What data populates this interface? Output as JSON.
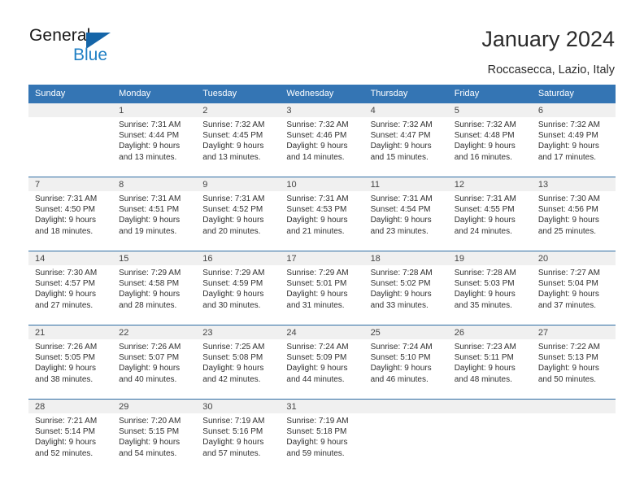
{
  "brand": {
    "name_top": "General",
    "name_bottom": "Blue",
    "triangle_color": "#1565a8",
    "blue_color": "#1f7fc4"
  },
  "header": {
    "title": "January 2024",
    "location": "Roccasecca, Lazio, Italy"
  },
  "calendar": {
    "header_bg": "#3475b4",
    "row_border": "#2e6da4",
    "daynum_bg": "#f0f0f0",
    "weekdays": [
      "Sunday",
      "Monday",
      "Tuesday",
      "Wednesday",
      "Thursday",
      "Friday",
      "Saturday"
    ],
    "weeks": [
      [
        {
          "day": "",
          "sunrise": "",
          "sunset": "",
          "daylight1": "",
          "daylight2": ""
        },
        {
          "day": "1",
          "sunrise": "Sunrise: 7:31 AM",
          "sunset": "Sunset: 4:44 PM",
          "daylight1": "Daylight: 9 hours",
          "daylight2": "and 13 minutes."
        },
        {
          "day": "2",
          "sunrise": "Sunrise: 7:32 AM",
          "sunset": "Sunset: 4:45 PM",
          "daylight1": "Daylight: 9 hours",
          "daylight2": "and 13 minutes."
        },
        {
          "day": "3",
          "sunrise": "Sunrise: 7:32 AM",
          "sunset": "Sunset: 4:46 PM",
          "daylight1": "Daylight: 9 hours",
          "daylight2": "and 14 minutes."
        },
        {
          "day": "4",
          "sunrise": "Sunrise: 7:32 AM",
          "sunset": "Sunset: 4:47 PM",
          "daylight1": "Daylight: 9 hours",
          "daylight2": "and 15 minutes."
        },
        {
          "day": "5",
          "sunrise": "Sunrise: 7:32 AM",
          "sunset": "Sunset: 4:48 PM",
          "daylight1": "Daylight: 9 hours",
          "daylight2": "and 16 minutes."
        },
        {
          "day": "6",
          "sunrise": "Sunrise: 7:32 AM",
          "sunset": "Sunset: 4:49 PM",
          "daylight1": "Daylight: 9 hours",
          "daylight2": "and 17 minutes."
        }
      ],
      [
        {
          "day": "7",
          "sunrise": "Sunrise: 7:31 AM",
          "sunset": "Sunset: 4:50 PM",
          "daylight1": "Daylight: 9 hours",
          "daylight2": "and 18 minutes."
        },
        {
          "day": "8",
          "sunrise": "Sunrise: 7:31 AM",
          "sunset": "Sunset: 4:51 PM",
          "daylight1": "Daylight: 9 hours",
          "daylight2": "and 19 minutes."
        },
        {
          "day": "9",
          "sunrise": "Sunrise: 7:31 AM",
          "sunset": "Sunset: 4:52 PM",
          "daylight1": "Daylight: 9 hours",
          "daylight2": "and 20 minutes."
        },
        {
          "day": "10",
          "sunrise": "Sunrise: 7:31 AM",
          "sunset": "Sunset: 4:53 PM",
          "daylight1": "Daylight: 9 hours",
          "daylight2": "and 21 minutes."
        },
        {
          "day": "11",
          "sunrise": "Sunrise: 7:31 AM",
          "sunset": "Sunset: 4:54 PM",
          "daylight1": "Daylight: 9 hours",
          "daylight2": "and 23 minutes."
        },
        {
          "day": "12",
          "sunrise": "Sunrise: 7:31 AM",
          "sunset": "Sunset: 4:55 PM",
          "daylight1": "Daylight: 9 hours",
          "daylight2": "and 24 minutes."
        },
        {
          "day": "13",
          "sunrise": "Sunrise: 7:30 AM",
          "sunset": "Sunset: 4:56 PM",
          "daylight1": "Daylight: 9 hours",
          "daylight2": "and 25 minutes."
        }
      ],
      [
        {
          "day": "14",
          "sunrise": "Sunrise: 7:30 AM",
          "sunset": "Sunset: 4:57 PM",
          "daylight1": "Daylight: 9 hours",
          "daylight2": "and 27 minutes."
        },
        {
          "day": "15",
          "sunrise": "Sunrise: 7:29 AM",
          "sunset": "Sunset: 4:58 PM",
          "daylight1": "Daylight: 9 hours",
          "daylight2": "and 28 minutes."
        },
        {
          "day": "16",
          "sunrise": "Sunrise: 7:29 AM",
          "sunset": "Sunset: 4:59 PM",
          "daylight1": "Daylight: 9 hours",
          "daylight2": "and 30 minutes."
        },
        {
          "day": "17",
          "sunrise": "Sunrise: 7:29 AM",
          "sunset": "Sunset: 5:01 PM",
          "daylight1": "Daylight: 9 hours",
          "daylight2": "and 31 minutes."
        },
        {
          "day": "18",
          "sunrise": "Sunrise: 7:28 AM",
          "sunset": "Sunset: 5:02 PM",
          "daylight1": "Daylight: 9 hours",
          "daylight2": "and 33 minutes."
        },
        {
          "day": "19",
          "sunrise": "Sunrise: 7:28 AM",
          "sunset": "Sunset: 5:03 PM",
          "daylight1": "Daylight: 9 hours",
          "daylight2": "and 35 minutes."
        },
        {
          "day": "20",
          "sunrise": "Sunrise: 7:27 AM",
          "sunset": "Sunset: 5:04 PM",
          "daylight1": "Daylight: 9 hours",
          "daylight2": "and 37 minutes."
        }
      ],
      [
        {
          "day": "21",
          "sunrise": "Sunrise: 7:26 AM",
          "sunset": "Sunset: 5:05 PM",
          "daylight1": "Daylight: 9 hours",
          "daylight2": "and 38 minutes."
        },
        {
          "day": "22",
          "sunrise": "Sunrise: 7:26 AM",
          "sunset": "Sunset: 5:07 PM",
          "daylight1": "Daylight: 9 hours",
          "daylight2": "and 40 minutes."
        },
        {
          "day": "23",
          "sunrise": "Sunrise: 7:25 AM",
          "sunset": "Sunset: 5:08 PM",
          "daylight1": "Daylight: 9 hours",
          "daylight2": "and 42 minutes."
        },
        {
          "day": "24",
          "sunrise": "Sunrise: 7:24 AM",
          "sunset": "Sunset: 5:09 PM",
          "daylight1": "Daylight: 9 hours",
          "daylight2": "and 44 minutes."
        },
        {
          "day": "25",
          "sunrise": "Sunrise: 7:24 AM",
          "sunset": "Sunset: 5:10 PM",
          "daylight1": "Daylight: 9 hours",
          "daylight2": "and 46 minutes."
        },
        {
          "day": "26",
          "sunrise": "Sunrise: 7:23 AM",
          "sunset": "Sunset: 5:11 PM",
          "daylight1": "Daylight: 9 hours",
          "daylight2": "and 48 minutes."
        },
        {
          "day": "27",
          "sunrise": "Sunrise: 7:22 AM",
          "sunset": "Sunset: 5:13 PM",
          "daylight1": "Daylight: 9 hours",
          "daylight2": "and 50 minutes."
        }
      ],
      [
        {
          "day": "28",
          "sunrise": "Sunrise: 7:21 AM",
          "sunset": "Sunset: 5:14 PM",
          "daylight1": "Daylight: 9 hours",
          "daylight2": "and 52 minutes."
        },
        {
          "day": "29",
          "sunrise": "Sunrise: 7:20 AM",
          "sunset": "Sunset: 5:15 PM",
          "daylight1": "Daylight: 9 hours",
          "daylight2": "and 54 minutes."
        },
        {
          "day": "30",
          "sunrise": "Sunrise: 7:19 AM",
          "sunset": "Sunset: 5:16 PM",
          "daylight1": "Daylight: 9 hours",
          "daylight2": "and 57 minutes."
        },
        {
          "day": "31",
          "sunrise": "Sunrise: 7:19 AM",
          "sunset": "Sunset: 5:18 PM",
          "daylight1": "Daylight: 9 hours",
          "daylight2": "and 59 minutes."
        },
        {
          "day": "",
          "sunrise": "",
          "sunset": "",
          "daylight1": "",
          "daylight2": ""
        },
        {
          "day": "",
          "sunrise": "",
          "sunset": "",
          "daylight1": "",
          "daylight2": ""
        },
        {
          "day": "",
          "sunrise": "",
          "sunset": "",
          "daylight1": "",
          "daylight2": ""
        }
      ]
    ]
  }
}
